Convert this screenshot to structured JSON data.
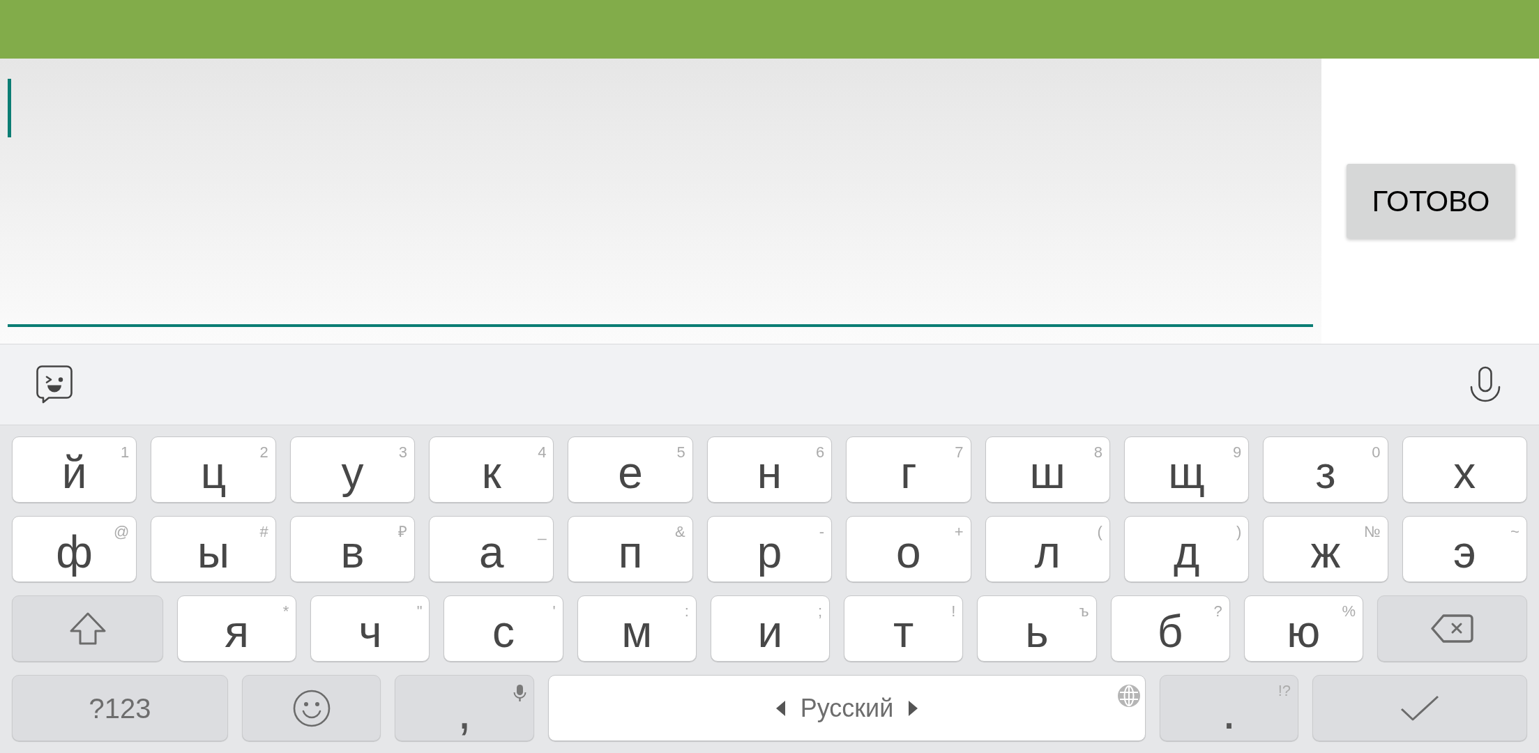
{
  "editor": {
    "focused": true
  },
  "done_button": {
    "label": "ГОТОВО"
  },
  "keyboard": {
    "rows": [
      [
        {
          "kind": "letter",
          "label": "й",
          "hint": "1"
        },
        {
          "kind": "letter",
          "label": "ц",
          "hint": "2"
        },
        {
          "kind": "letter",
          "label": "у",
          "hint": "3"
        },
        {
          "kind": "letter",
          "label": "к",
          "hint": "4"
        },
        {
          "kind": "letter",
          "label": "е",
          "hint": "5"
        },
        {
          "kind": "letter",
          "label": "н",
          "hint": "6"
        },
        {
          "kind": "letter",
          "label": "г",
          "hint": "7"
        },
        {
          "kind": "letter",
          "label": "ш",
          "hint": "8"
        },
        {
          "kind": "letter",
          "label": "щ",
          "hint": "9"
        },
        {
          "kind": "letter",
          "label": "з",
          "hint": "0"
        },
        {
          "kind": "letter",
          "label": "х"
        }
      ],
      [
        {
          "kind": "letter",
          "label": "ф",
          "hint": "@"
        },
        {
          "kind": "letter",
          "label": "ы",
          "hint": "#"
        },
        {
          "kind": "letter",
          "label": "в",
          "hint": "₽"
        },
        {
          "kind": "letter",
          "label": "а",
          "hint": "_"
        },
        {
          "kind": "letter",
          "label": "п",
          "hint": "&"
        },
        {
          "kind": "letter",
          "label": "р",
          "hint": "-"
        },
        {
          "kind": "letter",
          "label": "о",
          "hint": "+"
        },
        {
          "kind": "letter",
          "label": "л",
          "hint": "("
        },
        {
          "kind": "letter",
          "label": "д",
          "hint": ")"
        },
        {
          "kind": "letter",
          "label": "ж",
          "hint": "№"
        },
        {
          "kind": "letter",
          "label": "э",
          "hint": "~"
        }
      ],
      [
        {
          "kind": "shift"
        },
        {
          "kind": "letter",
          "label": "я",
          "hint": "*"
        },
        {
          "kind": "letter",
          "label": "ч",
          "hint": "\""
        },
        {
          "kind": "letter",
          "label": "с",
          "hint": "'"
        },
        {
          "kind": "letter",
          "label": "м",
          "hint": ":"
        },
        {
          "kind": "letter",
          "label": "и",
          "hint": ";"
        },
        {
          "kind": "letter",
          "label": "т",
          "hint": "!"
        },
        {
          "kind": "letter",
          "label": "ь",
          "hint": "ъ"
        },
        {
          "kind": "letter",
          "label": "б",
          "hint": "?"
        },
        {
          "kind": "letter",
          "label": "ю",
          "hint": "%"
        },
        {
          "kind": "backspace"
        }
      ],
      [
        {
          "kind": "symbols",
          "label": "?123"
        },
        {
          "kind": "emoji"
        },
        {
          "kind": "comma",
          "label": ","
        },
        {
          "kind": "space",
          "label": "Русский"
        },
        {
          "kind": "period",
          "label": ".",
          "hint": "!?"
        },
        {
          "kind": "enter"
        }
      ]
    ]
  }
}
